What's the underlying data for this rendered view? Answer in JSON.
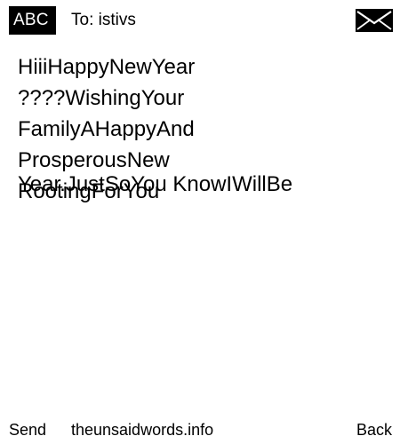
{
  "header": {
    "mode_label": "ABC",
    "recipient": "To: istivs",
    "status_icon": "envelope-icon"
  },
  "message": {
    "body": "HiiiHappyNewYear ????WishingYour FamilyAHappyAnd ProsperousNew RootingForYou",
    "overlay": "Year.JustSoYou KnowIWillBe"
  },
  "footer": {
    "left_softkey": "Send",
    "center_text": "theunsaidwords.info",
    "right_softkey": "Back"
  },
  "colors": {
    "background": "#ffffff",
    "text": "#000000",
    "badge": "#000000"
  }
}
